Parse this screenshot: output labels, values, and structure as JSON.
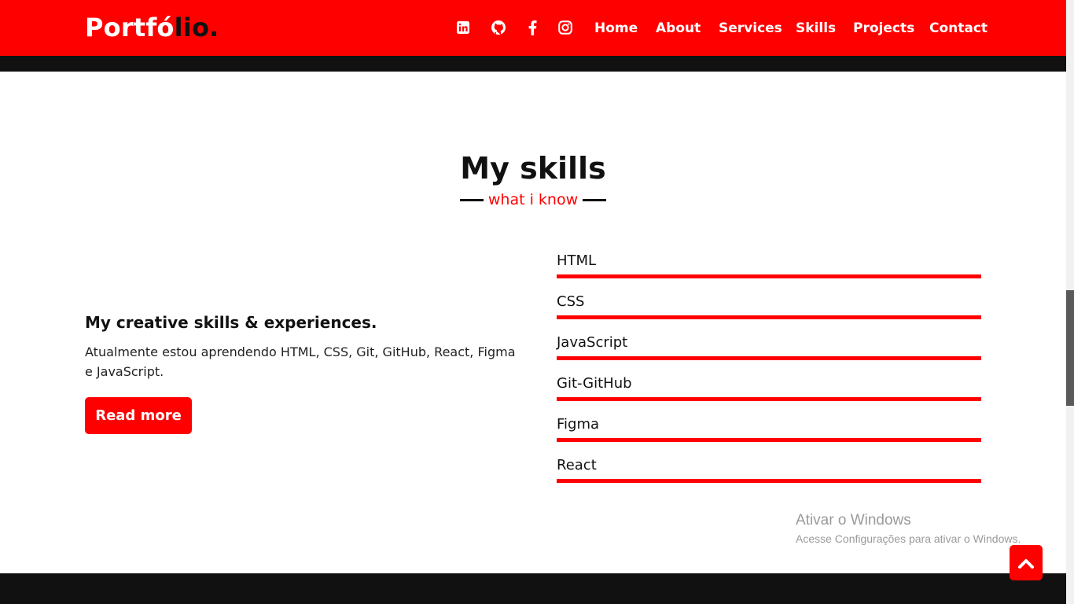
{
  "brand": {
    "logo_main": "Portfó",
    "logo_accent": "lio."
  },
  "nav": {
    "icons": [
      "linkedin-icon",
      "github-icon",
      "facebook-icon",
      "instagram-icon"
    ],
    "links": [
      "Home",
      "About",
      "Services",
      "Skills",
      "Projects",
      "Contact"
    ]
  },
  "section": {
    "title": "My skills",
    "subtitle": "what i know"
  },
  "intro": {
    "heading": "My creative skills & experiences.",
    "text": "Atualmente estou aprendendo HTML, CSS, Git, GitHub, React, Figma e JavaScript.",
    "button": "Read more"
  },
  "skills": [
    {
      "name": "HTML",
      "level": 1.0
    },
    {
      "name": "CSS",
      "level": 1.0
    },
    {
      "name": "JavaScript",
      "level": 1.0
    },
    {
      "name": "Git-GitHub",
      "level": 1.0
    },
    {
      "name": "Figma",
      "level": 1.0
    },
    {
      "name": "React",
      "level": 1.0
    }
  ],
  "watermark": {
    "title": "Ativar o Windows",
    "text": "Acesse Configurações para ativar o Windows."
  },
  "colors": {
    "accent": "#ff0000",
    "dark": "#111111",
    "background": "#ffffff"
  }
}
